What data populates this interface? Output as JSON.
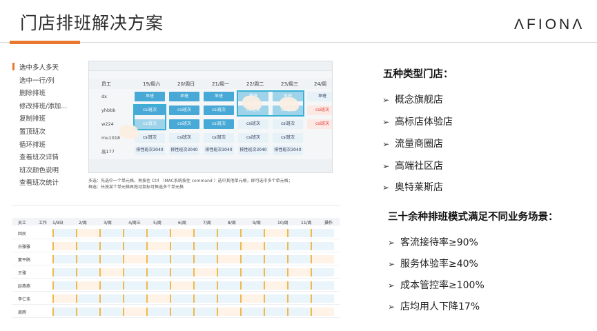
{
  "header": {
    "title": "门店排班解决方案",
    "brand": "ΛFIONΛ"
  },
  "menu": [
    "选中多人多天",
    "选中一行/列",
    "删除排班",
    "修改排班/添加...",
    "复制排班",
    "置顶班次",
    "循环排班",
    "查看班次详情",
    "班次颜色说明",
    "查看班次统计"
  ],
  "shot_top": {
    "columns": [
      "员工",
      "19/周六",
      "20/周日",
      "21/周一",
      "22/周二",
      "23/周三",
      "24/周"
    ],
    "rows": [
      "dx",
      "yhbbb",
      "w224",
      "mu1018",
      "高177"
    ],
    "cell_text": [
      "早班",
      "csi班次",
      "晚班",
      "csi班次",
      "排性班次3040"
    ],
    "caption": [
      "多选：先选中一个单元格，再按住 Ctrl （MAC系统按住 command ）选中其他单元格，即可选中多个单元格；",
      "框选：长按某个单元格再拖动鼠标可框选多个单元格"
    ]
  },
  "shot_bottom": {
    "header": [
      "员工",
      "工作",
      "1/9日",
      "2/周",
      "3/周",
      "4/周三",
      "5/周",
      "6/周",
      "7/周",
      "8/周",
      "9/周",
      "10/周",
      "11/周",
      "12/周",
      "13/周",
      "操作"
    ],
    "rows": [
      "回民",
      "白雅雅",
      "蒙平鹃",
      "王雅",
      "赵燕燕",
      "李仁伟",
      "周雨"
    ]
  },
  "store_types": {
    "title": "五种类型门店：",
    "items": [
      "概念旗舰店",
      "高标店体验店",
      "流量商圈店",
      "高端社区店",
      "奥特莱斯店"
    ]
  },
  "kpis": {
    "title": "三十余种排班模式满足不同业务场景：",
    "items": [
      "客流接待率≥90%",
      "服务体验率≥40%",
      "成本管控率≥100%",
      "店均用人下降17%"
    ]
  },
  "colors": {
    "accent": "#e8782d",
    "cell_blue": "#48a9d6",
    "select_border": "#38b1d5"
  }
}
